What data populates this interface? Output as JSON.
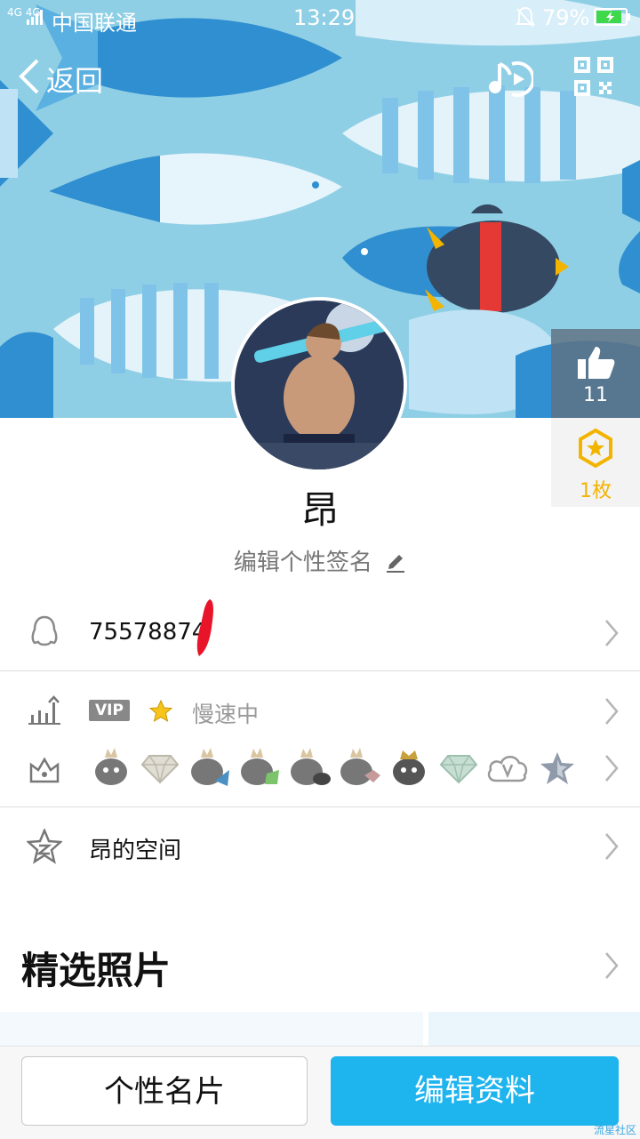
{
  "status_bar": {
    "network": "4G 4G",
    "carrier": "中国联通",
    "time": "13:29",
    "battery": "79%"
  },
  "nav": {
    "back_label": "返回",
    "music_icon": "music-note-play-icon",
    "qr_icon": "qr-code-icon"
  },
  "likes": {
    "count": "11",
    "icon": "thumbs-up-icon"
  },
  "badge": {
    "count": "1枚",
    "icon": "star-badge-icon"
  },
  "profile": {
    "nickname": "昂",
    "signature_placeholder": "编辑个性签名",
    "qq_number": "75578874"
  },
  "vip_row": {
    "vip_label": "VIP",
    "speed_status": "慢速中"
  },
  "space_row": {
    "label": "昂的空间"
  },
  "section": {
    "title": "精选照片"
  },
  "bottom": {
    "card_label": "个性名片",
    "edit_label": "编辑资料"
  },
  "watermark": "流星社区",
  "colors": {
    "header_bg": "#8fcfe6",
    "accent_blue": "#1eb4ee",
    "badge_gold": "#f3b400",
    "side_panel": "#607080"
  }
}
